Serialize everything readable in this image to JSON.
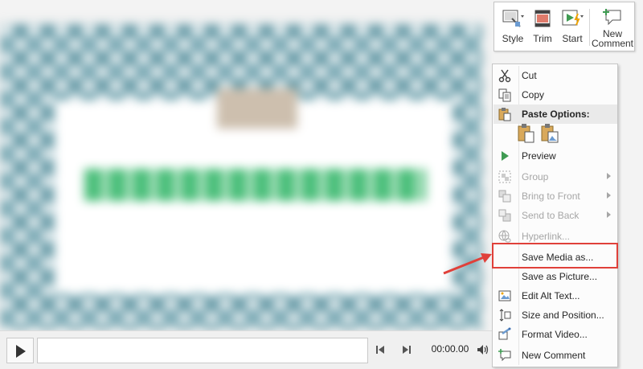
{
  "mini_toolbar": {
    "style_label": "Style",
    "trim_label": "Trim",
    "start_label": "Start",
    "new_comment_line1": "New",
    "new_comment_line2": "Comment"
  },
  "media_bar": {
    "time": "00:00.00"
  },
  "context_menu": {
    "items": [
      {
        "label": "Cut",
        "icon": "scissors-icon",
        "enabled": true
      },
      {
        "label": "Copy",
        "icon": "copy-icon",
        "enabled": true
      },
      {
        "label": "Paste Options:",
        "icon": "clipboard-icon",
        "enabled": true
      },
      {
        "label": "Preview",
        "icon": "play-icon",
        "enabled": true
      },
      {
        "label": "Group",
        "icon": "group-icon",
        "enabled": false
      },
      {
        "label": "Bring to Front",
        "icon": "bring-to-front-icon",
        "enabled": false
      },
      {
        "label": "Send to Back",
        "icon": "send-to-back-icon",
        "enabled": false
      },
      {
        "label": "Hyperlink...",
        "icon": "hyperlink-icon",
        "enabled": false
      },
      {
        "label": "Save Media as...",
        "icon": "",
        "enabled": true
      },
      {
        "label": "Save as Picture...",
        "icon": "",
        "enabled": true
      },
      {
        "label": "Edit Alt Text...",
        "icon": "alt-text-icon",
        "enabled": true
      },
      {
        "label": "Size and Position...",
        "icon": "size-position-icon",
        "enabled": true
      },
      {
        "label": "Format Video...",
        "icon": "format-video-icon",
        "enabled": true
      },
      {
        "label": "New Comment",
        "icon": "new-comment-icon",
        "enabled": true
      }
    ]
  },
  "colors": {
    "highlight": "#e0403a",
    "accent_green": "#3f9b52"
  }
}
